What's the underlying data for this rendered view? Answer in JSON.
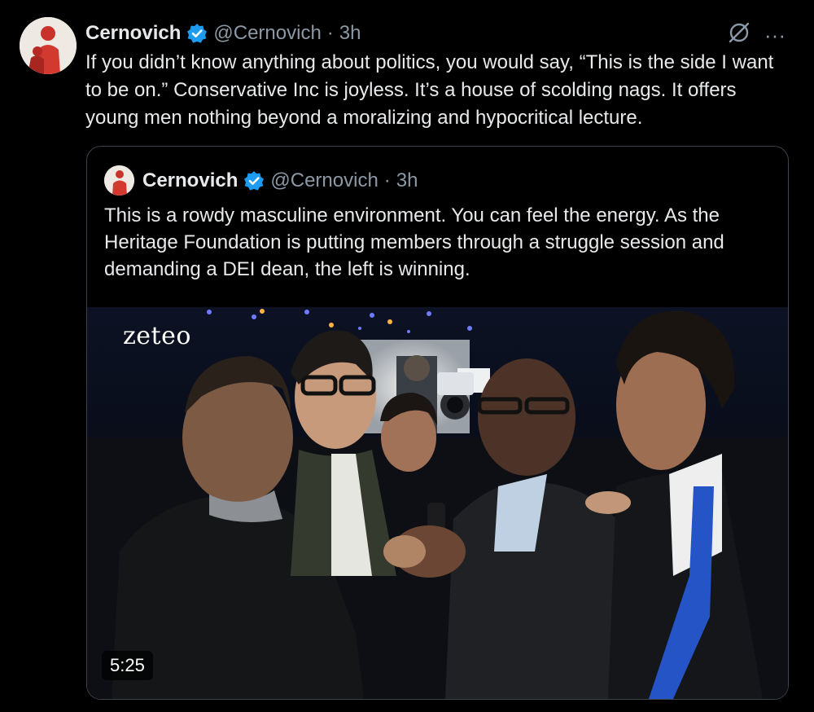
{
  "tweet": {
    "author_name": "Cernovich",
    "handle": "@Cernovich",
    "separator": "·",
    "time": "3h",
    "verified_icon": "verified-badge-icon",
    "text": "If you didn’t know anything about politics, you would say, “This is the side I want to be on.” Conservative Inc is joyless. It’s a house of scolding nags. It offers young men nothing beyond a moralizing and hypocritical lecture.",
    "actions": {
      "grok_icon": "grok-icon",
      "more_label": "···"
    }
  },
  "quoted_tweet": {
    "author_name": "Cernovich",
    "handle": "@Cernovich",
    "separator": "·",
    "time": "3h",
    "text": "This is a rowdy masculine environment. You can feel the energy. As the Heritage Foundation is putting members through a struggle session and demanding a DEI dean, the left is winning.",
    "media": {
      "watermark": "zeteo",
      "duration": "5:25"
    }
  },
  "colors": {
    "background": "#000000",
    "text": "#e7e9ea",
    "muted": "#8b98a5",
    "verified": "#1d9bf0",
    "border": "#3d4348"
  }
}
